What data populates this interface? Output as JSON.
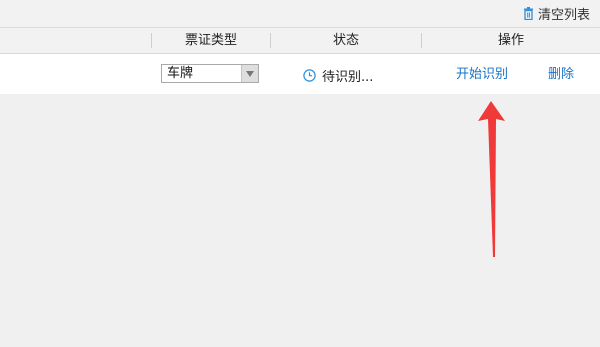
{
  "toolbar": {
    "clear_list_label": "清空列表",
    "clear_list_icon": "trash-icon"
  },
  "table": {
    "columns": [
      "票证类型",
      "状态",
      "操作"
    ],
    "rows": [
      {
        "ticket_type": "车牌",
        "status": "待识别...",
        "status_icon": "clock-icon",
        "actions": [
          "开始识别",
          "删除"
        ]
      }
    ]
  },
  "colors": {
    "link": "#1a73c8",
    "annotation_arrow": "#f03a3a",
    "status_icon": "#2b8fe0"
  }
}
